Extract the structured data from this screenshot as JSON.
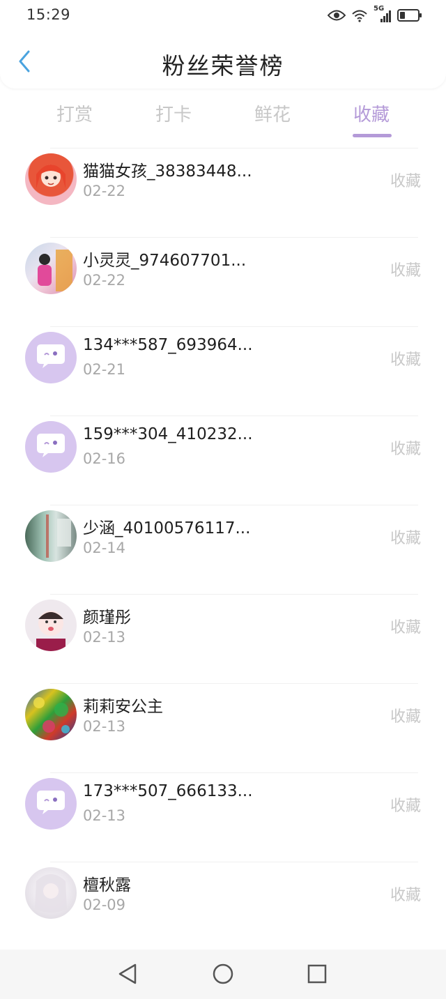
{
  "status_bar": {
    "time": "15:29",
    "signal_label": "5G",
    "icons": [
      "eye-icon",
      "wifi-icon",
      "cellular-signal-icon",
      "battery-icon"
    ]
  },
  "header": {
    "title": "粉丝荣誉榜",
    "back_icon": "chevron-left-icon"
  },
  "tabs": [
    {
      "label": "打赏",
      "active": false
    },
    {
      "label": "打卡",
      "active": false
    },
    {
      "label": "鲜花",
      "active": false
    },
    {
      "label": "收藏",
      "active": true
    }
  ],
  "colors": {
    "accent": "#b49ad8",
    "back_icon": "#4aa3df",
    "default_avatar": "#d7c6ef"
  },
  "fans": [
    {
      "name": "猫猫女孩_38383448...",
      "date": "02-22",
      "action": "收藏",
      "avatar": "photo"
    },
    {
      "name": "小灵灵_974607701...",
      "date": "02-22",
      "action": "收藏",
      "avatar": "photo"
    },
    {
      "name": "134***587_693964...",
      "date": "02-21",
      "action": "收藏",
      "avatar": "default"
    },
    {
      "name": "159***304_410232...",
      "date": "02-16",
      "action": "收藏",
      "avatar": "default"
    },
    {
      "name": "少涵_40100576117...",
      "date": "02-14",
      "action": "收藏",
      "avatar": "photo"
    },
    {
      "name": "颜瑾彤",
      "date": "02-13",
      "action": "收藏",
      "avatar": "photo"
    },
    {
      "name": "莉莉安公主",
      "date": "02-13",
      "action": "收藏",
      "avatar": "photo"
    },
    {
      "name": "173***507_666133...",
      "date": "02-13",
      "action": "收藏",
      "avatar": "default"
    },
    {
      "name": "檀秋露",
      "date": "02-09",
      "action": "收藏",
      "avatar": "photo"
    }
  ],
  "nav_bar": {
    "icons": [
      "back-triangle-icon",
      "home-circle-icon",
      "recents-square-icon"
    ]
  }
}
